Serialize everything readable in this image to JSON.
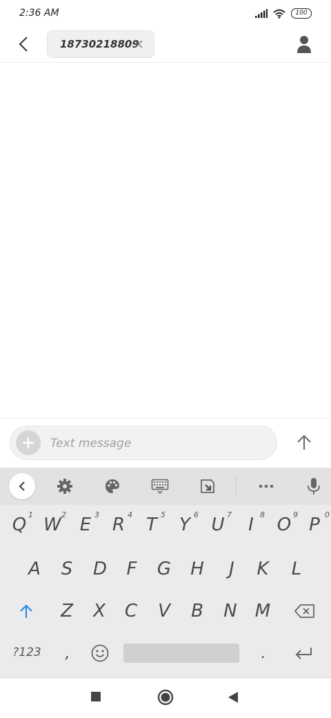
{
  "status_bar": {
    "time": "2:36 AM",
    "battery": "100",
    "icons": [
      "signal-icon",
      "wifi-icon",
      "battery-icon"
    ]
  },
  "header": {
    "recipient": "18730218809",
    "icons": [
      "back-arrow-icon",
      "close-icon",
      "contact-icon"
    ]
  },
  "compose": {
    "placeholder": "Text message",
    "value": "",
    "icons": [
      "plus-icon",
      "send-arrow-icon"
    ]
  },
  "keyboard": {
    "toolbar_icons": [
      "chevron-left-icon",
      "settings-gear-icon",
      "palette-icon",
      "keyboard-icon",
      "clipboard-icon",
      "more-dots-icon",
      "microphone-icon"
    ],
    "row1": [
      {
        "key": "Q",
        "num": "1"
      },
      {
        "key": "W",
        "num": "2"
      },
      {
        "key": "E",
        "num": "3"
      },
      {
        "key": "R",
        "num": "4"
      },
      {
        "key": "T",
        "num": "5"
      },
      {
        "key": "Y",
        "num": "6"
      },
      {
        "key": "U",
        "num": "7"
      },
      {
        "key": "I",
        "num": "8"
      },
      {
        "key": "O",
        "num": "9"
      },
      {
        "key": "P",
        "num": "0"
      }
    ],
    "row2": [
      "A",
      "S",
      "D",
      "F",
      "G",
      "H",
      "J",
      "K",
      "L"
    ],
    "row3": [
      "Z",
      "X",
      "C",
      "V",
      "B",
      "N",
      "M"
    ],
    "row4": {
      "symbols": "?123",
      "comma": ",",
      "period": "."
    },
    "accent_color": "#2b8be6"
  },
  "nav_bar": {
    "icons": [
      "recent-apps-square-icon",
      "home-circle-icon",
      "back-triangle-icon"
    ]
  }
}
